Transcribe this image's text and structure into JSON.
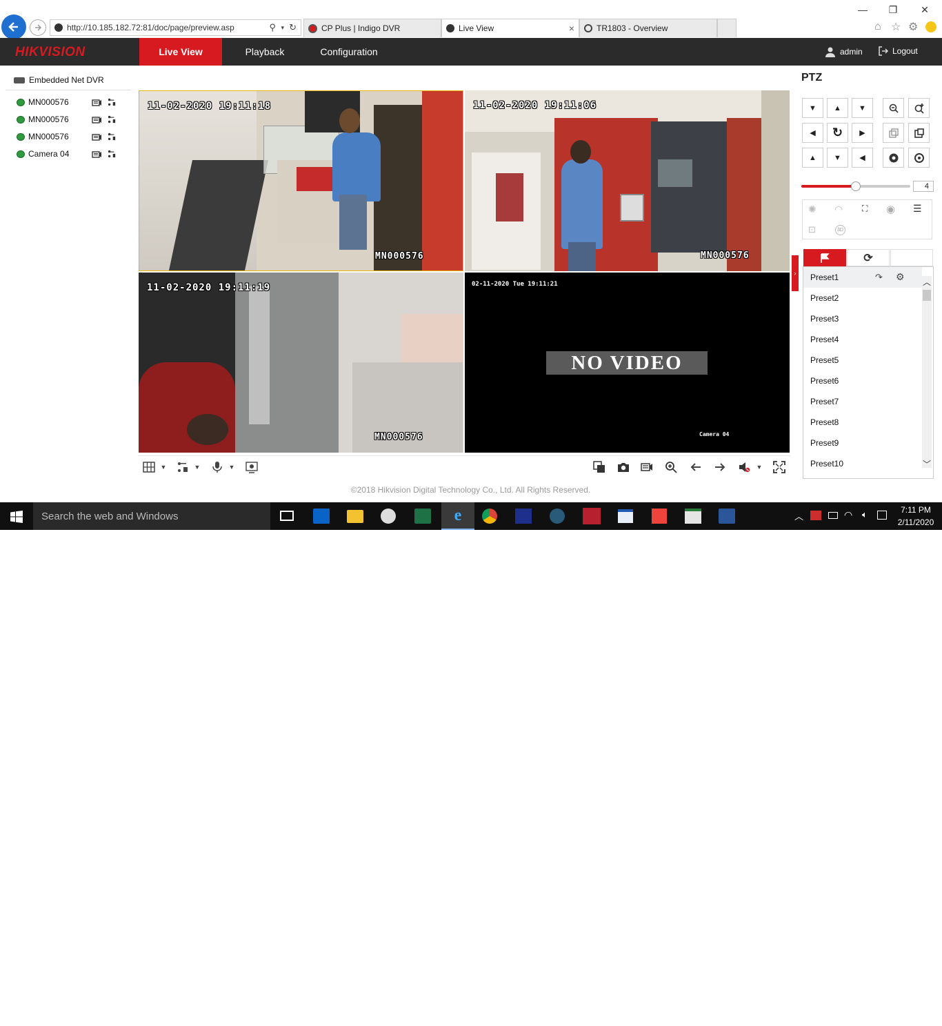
{
  "browser": {
    "url": "http://10.185.182.72:81/doc/page/preview.asp",
    "tabs": [
      {
        "label": "CP Plus | Indigo DVR",
        "active": false
      },
      {
        "label": "Live View",
        "active": true
      },
      {
        "label": "TR1803 - Overview",
        "active": false
      }
    ],
    "tab_close": "×",
    "window_controls": {
      "minimize": "—",
      "restore": "❐",
      "close": "✕"
    }
  },
  "app": {
    "logo": "HIKVISION",
    "nav": [
      {
        "label": "Live View",
        "active": true
      },
      {
        "label": "Playback",
        "active": false
      },
      {
        "label": "Configuration",
        "active": false
      }
    ],
    "user": "admin",
    "logout": "Logout",
    "accent": "#d61a1f"
  },
  "device_tree": {
    "root": "Embedded Net DVR",
    "cameras": [
      "MN000576",
      "MN000576",
      "MN000576",
      "Camera 04"
    ]
  },
  "video": {
    "tiles": [
      {
        "timestamp": "11-02-2020 19:11:18",
        "label": "MN000576",
        "selected": true
      },
      {
        "timestamp": "11-02-2020 19:11:06",
        "label": "MN000576",
        "selected": false
      },
      {
        "timestamp": "11-02-2020 19:11:19",
        "label": "MN000576",
        "selected": false
      },
      {
        "timestamp": "02-11-2020 Tue 19:11:21",
        "label": "Camera 04",
        "no_video": "NO VIDEO"
      }
    ]
  },
  "ptz": {
    "title": "PTZ",
    "speed": "4",
    "speed_fraction": 0.5,
    "presets": [
      "Preset1",
      "Preset2",
      "Preset3",
      "Preset4",
      "Preset5",
      "Preset6",
      "Preset7",
      "Preset8",
      "Preset9",
      "Preset10"
    ]
  },
  "footer": "©2018 Hikvision Digital Technology Co., Ltd. All Rights Reserved.",
  "taskbar": {
    "search_placeholder": "Search the web and Windows",
    "time": "7:11 PM",
    "date": "2/11/2020"
  }
}
